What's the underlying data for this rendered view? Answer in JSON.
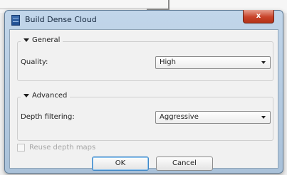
{
  "dialog": {
    "title": "Build Dense Cloud",
    "close_label": "x"
  },
  "general": {
    "header": "General",
    "quality_label": "Quality:",
    "quality_value": "High"
  },
  "advanced": {
    "header": "Advanced",
    "depth_filtering_label": "Depth filtering:",
    "depth_filtering_value": "Aggressive",
    "reuse_depth_maps_label": "Reuse depth maps",
    "reuse_depth_maps_checked": false
  },
  "buttons": {
    "ok_label": "OK",
    "cancel_label": "Cancel"
  }
}
